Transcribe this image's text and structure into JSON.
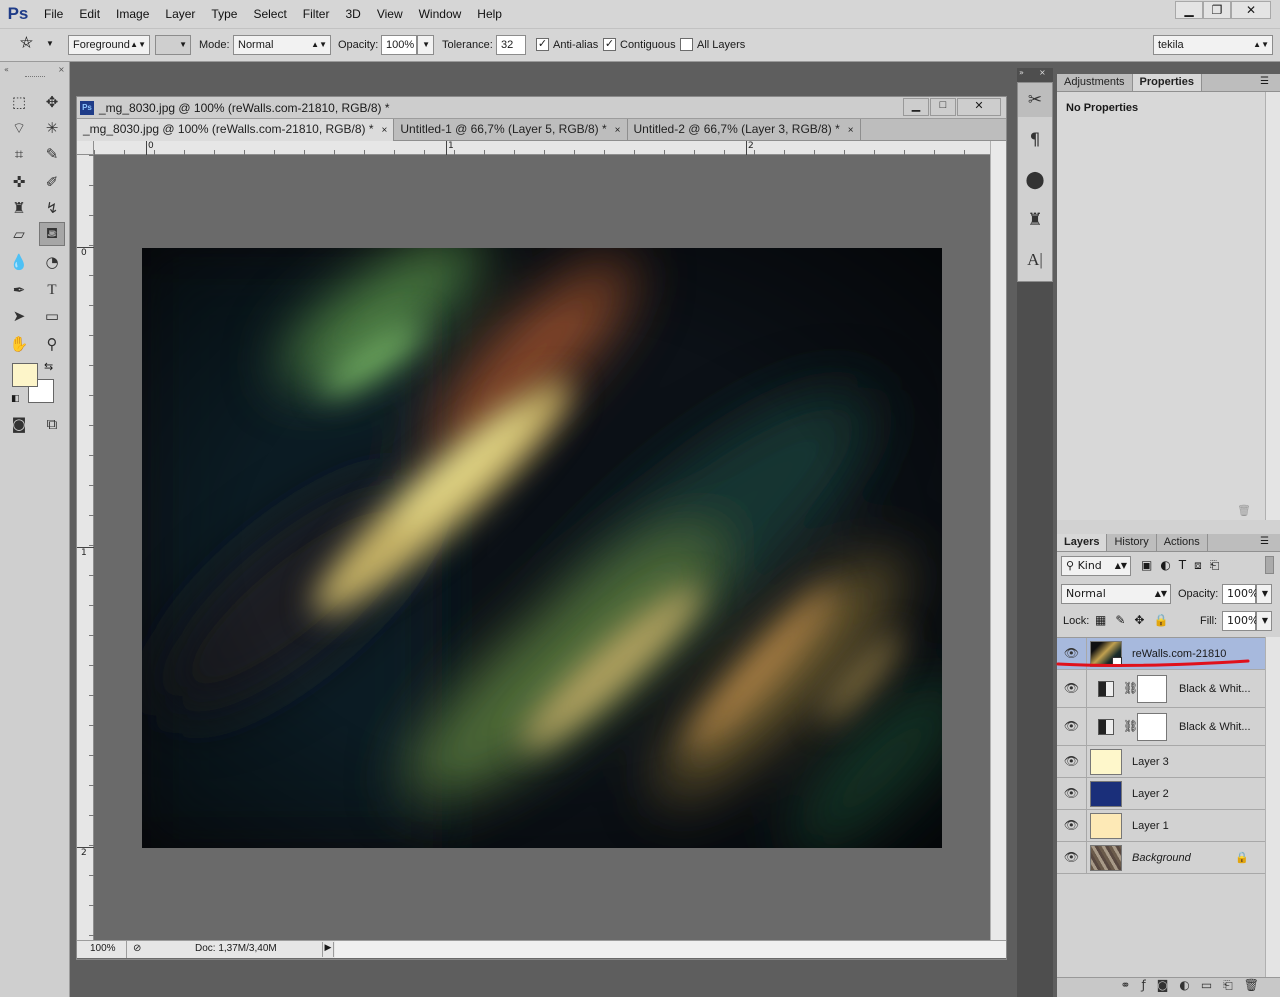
{
  "menubar": {
    "logo": "Ps",
    "items": [
      "File",
      "Edit",
      "Image",
      "Layer",
      "Type",
      "Select",
      "Filter",
      "3D",
      "View",
      "Window",
      "Help"
    ],
    "minimize": "▁",
    "restore": "❐",
    "close": "✕"
  },
  "options": {
    "fill_source": "Foreground",
    "mode_label": "Mode:",
    "mode_value": "Normal",
    "opacity_label": "Opacity:",
    "opacity_value": "100%",
    "tolerance_label": "Tolerance:",
    "tolerance_value": "32",
    "antialias_label": "Anti-alias",
    "antialias_checked": true,
    "contiguous_label": "Contiguous",
    "contiguous_checked": true,
    "alllayers_label": "All Layers",
    "alllayers_checked": false,
    "workspace": "tekila"
  },
  "colors": {
    "foreground": "#fdf5c9",
    "background": "#ffffff",
    "selected_layer": "#a7b9dd",
    "annotation": "#e0101a"
  },
  "document": {
    "ps_badge": "Ps",
    "title": "_mg_8030.jpg @ 100% (reWalls.com-21810, RGB/8) *",
    "tabs": [
      {
        "label": "_mg_8030.jpg @ 100% (reWalls.com-21810, RGB/8) *",
        "close": "×"
      },
      {
        "label": "Untitled-1 @ 66,7% (Layer 5, RGB/8) *",
        "close": "×"
      },
      {
        "label": "Untitled-2 @ 66,7% (Layer 3, RGB/8) *",
        "close": "×"
      }
    ],
    "ruler_h": [
      "0",
      "1",
      "2"
    ],
    "ruler_v": [
      "0",
      "1",
      "2"
    ],
    "zoom": "100%",
    "doc_info": "Doc: 1,37M/3,40M"
  },
  "adjustments": {
    "tabs": [
      "Adjustments",
      "Properties"
    ],
    "message": "No Properties"
  },
  "layers_panel": {
    "tabs": [
      "Layers",
      "History",
      "Actions"
    ],
    "filter_kind": "Kind",
    "blend_mode": "Normal",
    "opacity_label": "Opacity:",
    "opacity_value": "100%",
    "lock_label": "Lock:",
    "fill_label": "Fill:",
    "fill_value": "100%",
    "layers": [
      {
        "name": "reWalls.com-21810",
        "thumb": "#2a2a1a",
        "selected": true,
        "adjustment": false,
        "locked": false,
        "italic": false
      },
      {
        "name": "Black & Whit...",
        "thumb": "#ffffff",
        "selected": false,
        "adjustment": true,
        "locked": false,
        "italic": false
      },
      {
        "name": "Black & Whit...",
        "thumb": "#ffffff",
        "selected": false,
        "adjustment": true,
        "locked": false,
        "italic": false
      },
      {
        "name": "Layer 3",
        "thumb": "#fef7cb",
        "selected": false,
        "adjustment": false,
        "locked": false,
        "italic": false
      },
      {
        "name": "Layer 2",
        "thumb": "#1a2f7a",
        "selected": false,
        "adjustment": false,
        "locked": false,
        "italic": false
      },
      {
        "name": "Layer 1",
        "thumb": "#fde9b6",
        "selected": false,
        "adjustment": false,
        "locked": false,
        "italic": false
      },
      {
        "name": "Background",
        "thumb": "#8a7a6a",
        "selected": false,
        "adjustment": false,
        "locked": true,
        "italic": true
      }
    ]
  }
}
